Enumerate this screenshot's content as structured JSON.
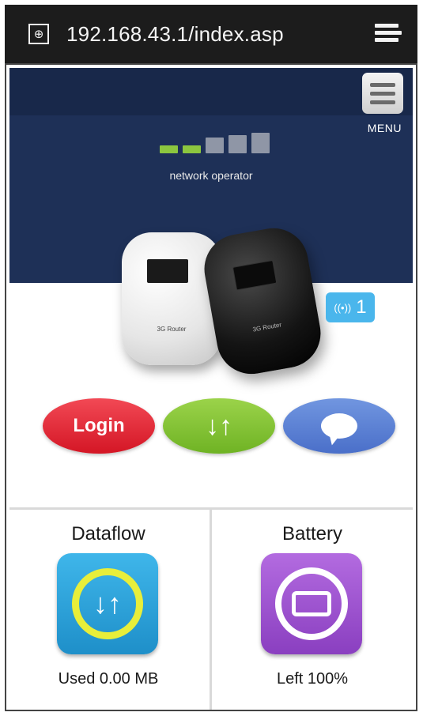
{
  "browser": {
    "url": "192.168.43.1/index.asp",
    "icons": {
      "site": "globe-icon",
      "overflow": "overflow-menu-icon"
    }
  },
  "header": {
    "menu_label": "MENU",
    "signal_bars_total": 5,
    "signal_bars_active": 2,
    "operator": "network operator",
    "device_labels": {
      "white": "3G Router",
      "black": "3G Router"
    },
    "connected_clients": "1",
    "colors": {
      "background": "#1e3057",
      "signal_on": "#8cc63f",
      "signal_off": "#8f96a6"
    }
  },
  "actions": {
    "login": "Login",
    "data_icon": "↓↑",
    "chat_icon": "chat-bubble-icon",
    "colors": {
      "login": "#d41625",
      "data": "#6fb324",
      "chat": "#4a6fc9"
    }
  },
  "panels": {
    "dataflow": {
      "title": "Dataflow",
      "value": "Used 0.00 MB",
      "icon": "↓↑"
    },
    "battery": {
      "title": "Battery",
      "value": "Left 100%",
      "icon": "battery-icon"
    }
  }
}
